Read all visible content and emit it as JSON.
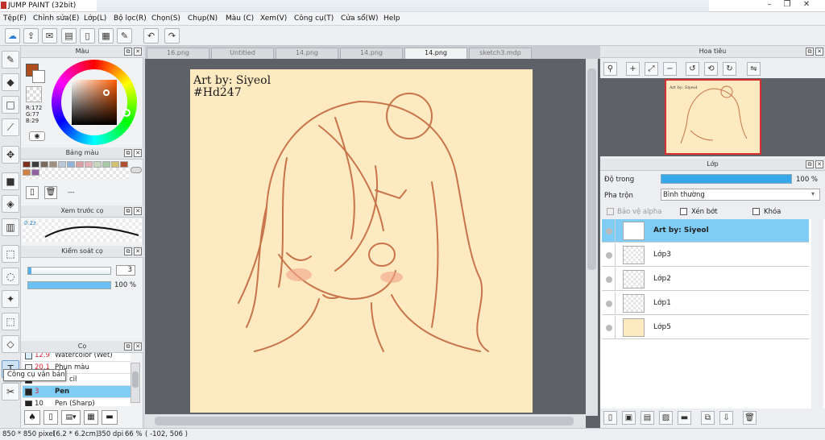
{
  "window": {
    "title": "JUMP PAINT (32bit)"
  },
  "menu": [
    "Tệp(F)",
    "Chỉnh sửa(E)",
    "Lớp(L)",
    "Bộ lọc(R)",
    "Chọn(S)",
    "Chụp(N)",
    "Màu (C)",
    "Xem(V)",
    "Công cụ(T)",
    "Cửa sổ(W)",
    "Help"
  ],
  "toolbar_icons": [
    "cloud-icon",
    "export-icon",
    "chat-icon",
    "comment-icon",
    "document-icon",
    "layout-icon",
    "settings-icon",
    "undo-icon",
    "redo-icon"
  ],
  "color_panel": {
    "title": "Màu",
    "r": "R:172",
    "g": "G:77",
    "b": "B:29",
    "main_color": "#ac4d1d"
  },
  "palette_panel": {
    "title": "Bảng màu",
    "more": "---",
    "swatches": [
      "#7a2f1a",
      "#3c3c3c",
      "#7a6a5e",
      "#a09080",
      "#b8c8d8",
      "#8fb3d9",
      "#d8a0a0",
      "#e5b0b8",
      "#c8d8c0",
      "#a7cba7",
      "#d0c070",
      "#b05030",
      "#d08040",
      "#9060a0",
      "#8a8a8a",
      "#60a0c0"
    ]
  },
  "brush_preview_panel": {
    "title": "Xem trước cọ",
    "size_label": "0.2z"
  },
  "brush_control_panel": {
    "title": "Kiểm soát cọ",
    "size_value": "3",
    "opacity_value": "100 %"
  },
  "brush_panel": {
    "title": "Cọ",
    "items": [
      {
        "size": "12.9",
        "name": "Watercolor (Wet)",
        "color": "#e0f0f8",
        "selected": false
      },
      {
        "size": "20.1",
        "name": "Phun màu",
        "color": "#f0f0f0",
        "selected": false
      },
      {
        "size": "",
        "name": "cil",
        "color": "#222222",
        "selected": false
      },
      {
        "size": "3",
        "name": "Pen",
        "color": "#222222",
        "selected": true
      },
      {
        "size": "10",
        "name": "Pen (Sharp)",
        "color": "#222222",
        "selected": false
      }
    ],
    "tooltip": "Công cụ văn bản"
  },
  "doc_tabs": [
    {
      "label": "16.png",
      "active": false
    },
    {
      "label": "Untitled",
      "active": false
    },
    {
      "label": "14.png",
      "active": false
    },
    {
      "label": "14.png",
      "active": false
    },
    {
      "label": "14.png",
      "active": true
    },
    {
      "label": "sketch3.mdp",
      "active": false
    }
  ],
  "artwork": {
    "credit_line1": "Art by: Siyeol",
    "credit_line2": "#Hd247",
    "ink_color": "#c8744a",
    "paper_color": "#fdeac1"
  },
  "navigator_panel": {
    "title": "Hoa tiêu"
  },
  "layer_panel": {
    "title": "Lớp",
    "opacity_label": "Độ trong",
    "opacity_value": "100 %",
    "blend_label": "Pha trộn",
    "blend_value": "Bình thường",
    "protect_alpha": "Bảo vệ alpha",
    "clip": "Xén bớt",
    "lock": "Khóa",
    "layers": [
      {
        "name": "Art by: Siyeol",
        "selected": true
      },
      {
        "name": "Lớp3",
        "selected": false
      },
      {
        "name": "Lớp2",
        "selected": false
      },
      {
        "name": "Lớp1",
        "selected": false
      },
      {
        "name": "Lớp5",
        "selected": false
      }
    ]
  },
  "status": {
    "size": "850 * 850 pixel",
    "print_size": "(6.2 * 6.2cm)",
    "dpi": "350 dpi",
    "zoom": "66 %",
    "coords": "( -102, 506 )"
  }
}
